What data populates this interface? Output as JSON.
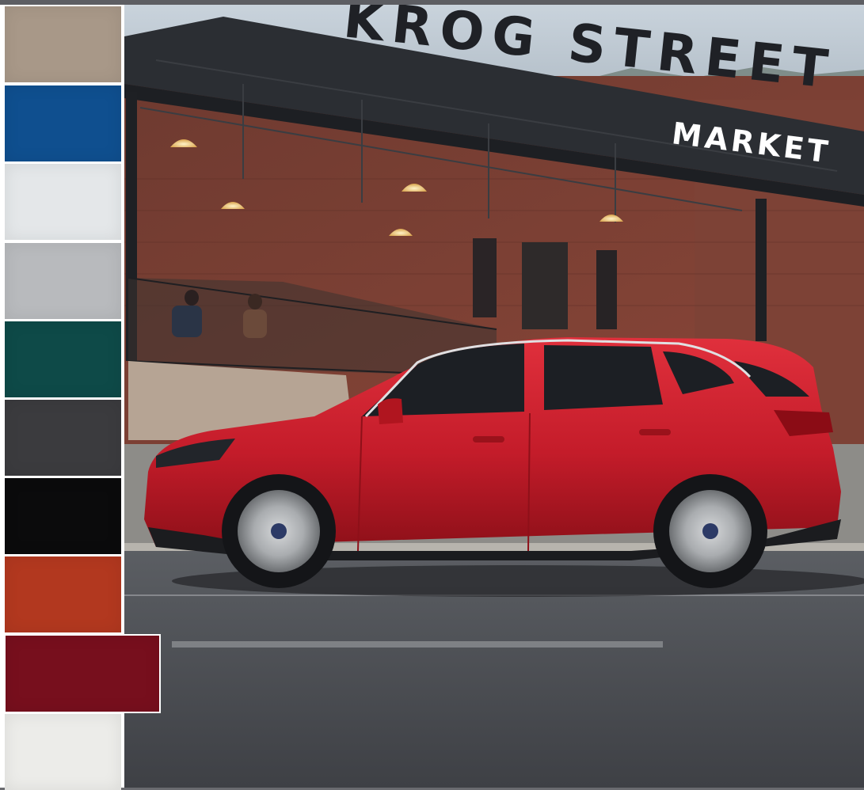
{
  "swatches": [
    {
      "name": "beige",
      "color": "#a89888",
      "selected": false
    },
    {
      "name": "blue",
      "color": "#0f4f8f",
      "selected": false
    },
    {
      "name": "white",
      "color": "#e4e7e9",
      "selected": false
    },
    {
      "name": "silver",
      "color": "#b8babd",
      "selected": false
    },
    {
      "name": "teal-green",
      "color": "#0e4a48",
      "selected": false
    },
    {
      "name": "dark-gray",
      "color": "#3b3b3e",
      "selected": false
    },
    {
      "name": "black",
      "color": "#0b0b0c",
      "selected": false
    },
    {
      "name": "orange-red",
      "color": "#b2381f",
      "selected": false
    },
    {
      "name": "crimson",
      "color": "#770f1d",
      "selected": true
    },
    {
      "name": "pearl-white",
      "color": "#ecece9",
      "selected": false
    }
  ],
  "sign": {
    "top": "KROG STREET",
    "bottom": "MARKET"
  },
  "car": {
    "color": "#c81e2c"
  }
}
